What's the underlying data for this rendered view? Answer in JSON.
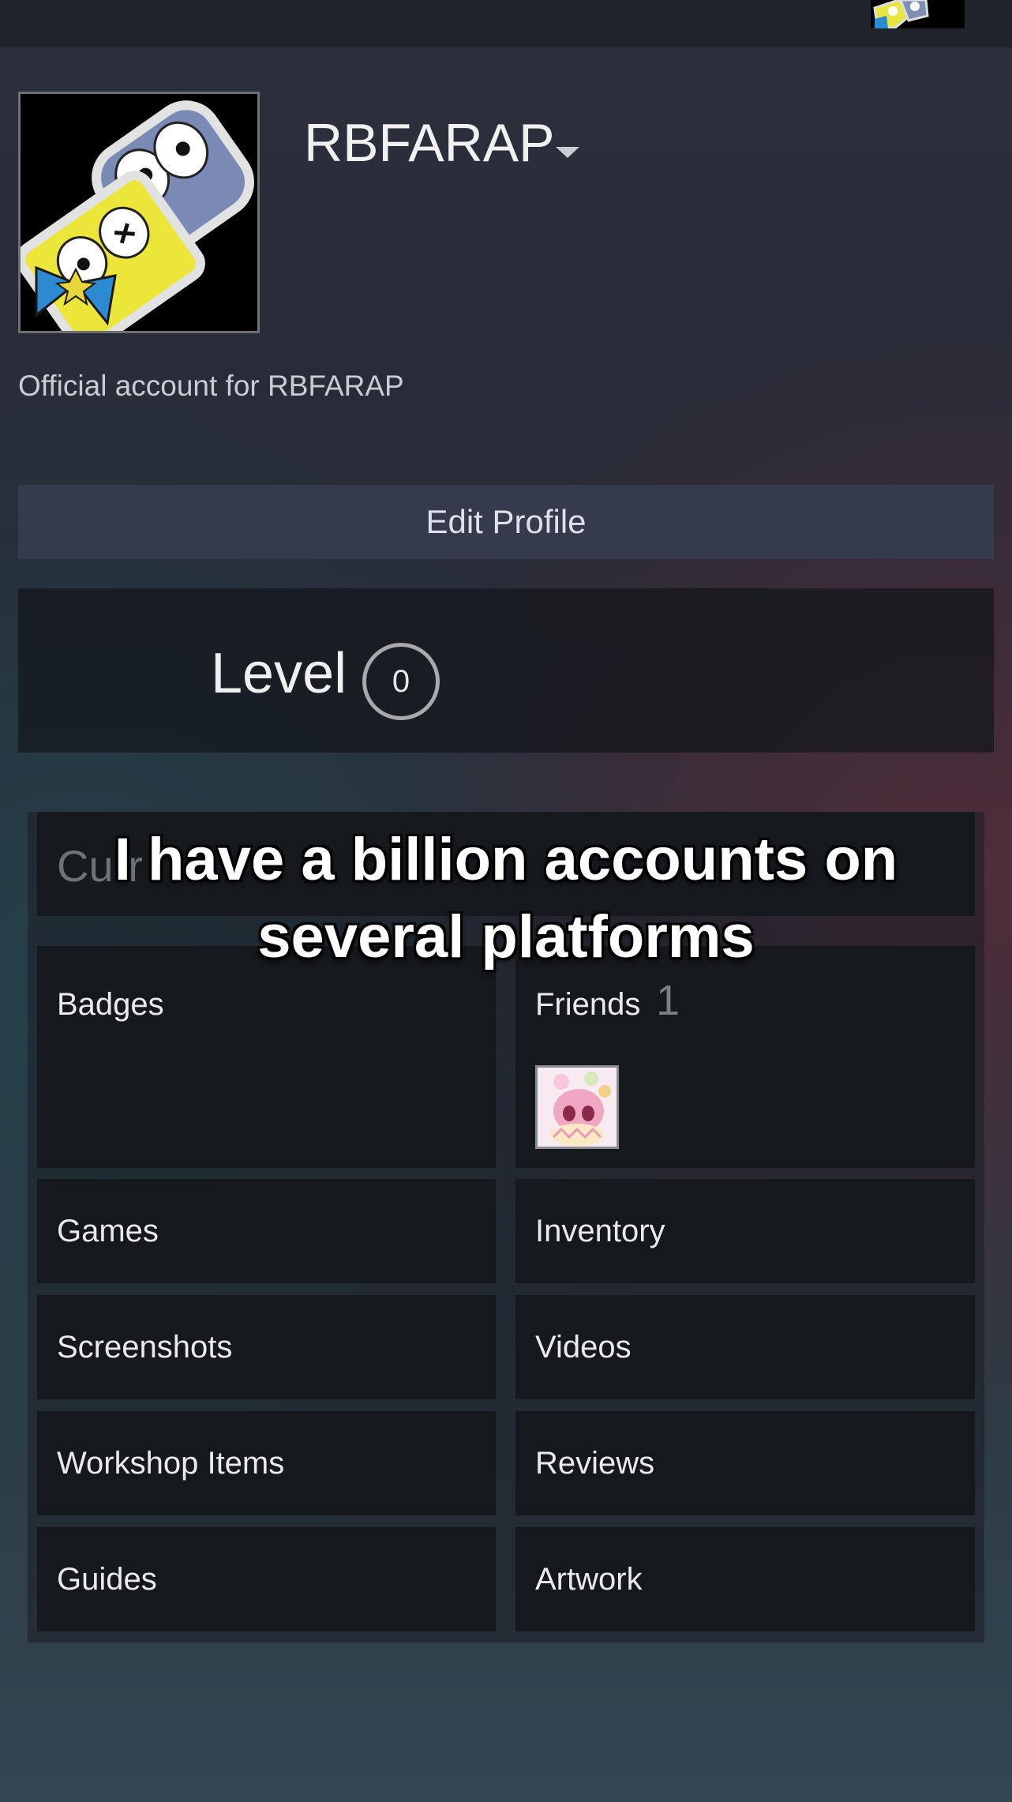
{
  "header": {
    "partial_text": ""
  },
  "profile": {
    "username": "RBFARAP",
    "summary": "Official account for RBFARAP",
    "edit_label": "Edit Profile",
    "level_label": "Level",
    "level_value": "0"
  },
  "showcase": {
    "partial_label": "Curr"
  },
  "tiles": {
    "badges": "Badges",
    "friends": "Friends",
    "friends_count": "1",
    "games": "Games",
    "inventory": "Inventory",
    "screenshots": "Screenshots",
    "videos": "Videos",
    "workshop": "Workshop Items",
    "reviews": "Reviews",
    "guides": "Guides",
    "artwork": "Artwork"
  },
  "overlay": {
    "caption_line1": "I have a billion accounts on",
    "caption_line2": "several platforms"
  },
  "icons": {
    "caret": "dropdown-caret-icon",
    "avatar": "cartoon-character-avatar",
    "friend_avatar": "pink-anime-avatar"
  },
  "colors": {
    "button_bg": "#353a4c",
    "tile_bg": "#15181c",
    "level_ring": "#a9a9ab"
  }
}
